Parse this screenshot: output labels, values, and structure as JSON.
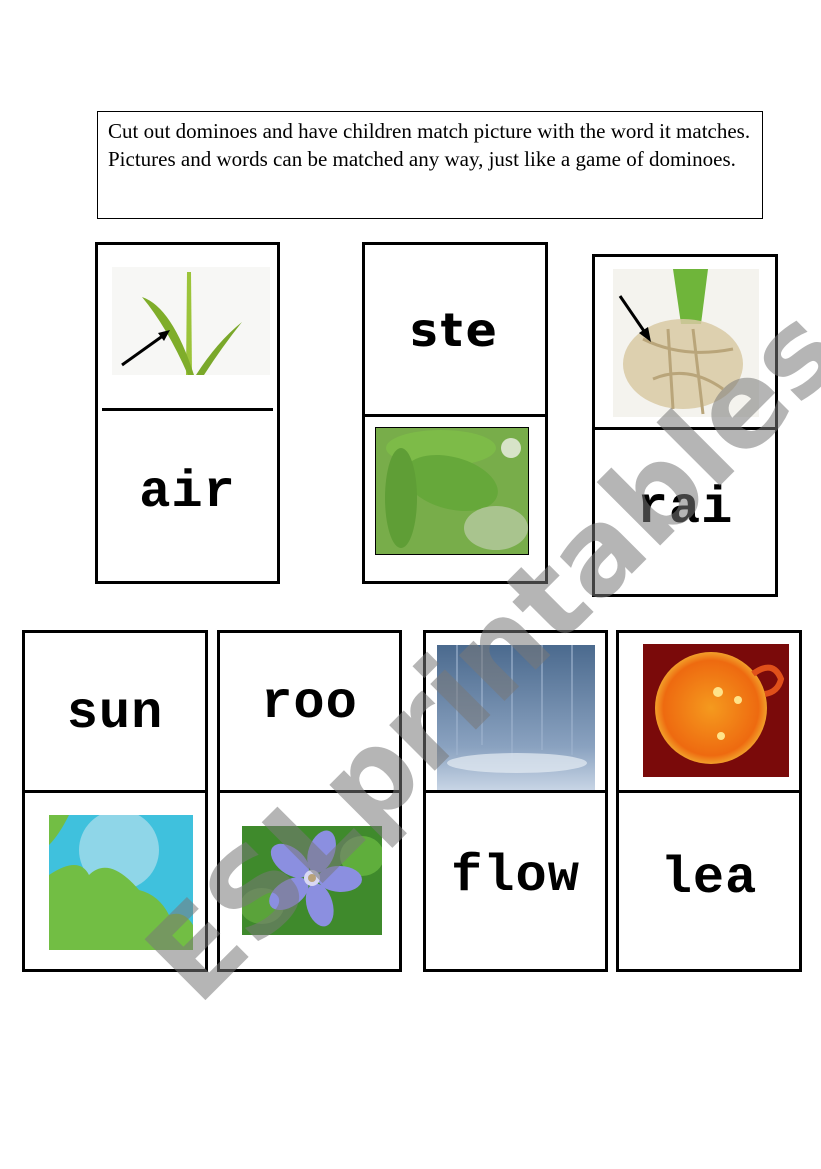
{
  "instructions": "Cut out dominoes and have children match picture with the word it matches.  Pictures and words can be matched any way, just like a game of dominoes.",
  "watermark": "ESLprintables.com",
  "dominoes": [
    {
      "top": {
        "type": "picture",
        "icon": "plant-stem-with-arrow-icon"
      },
      "bottom": {
        "type": "word",
        "text": "air"
      }
    },
    {
      "top": {
        "type": "word",
        "text": "ste"
      },
      "bottom": {
        "type": "picture",
        "icon": "leaves-icon"
      }
    },
    {
      "top": {
        "type": "picture",
        "icon": "roots-with-arrow-icon"
      },
      "bottom": {
        "type": "word",
        "text": "rai"
      }
    },
    {
      "top": {
        "type": "word",
        "text": "sun"
      },
      "bottom": {
        "type": "picture",
        "icon": "air-landscape-icon"
      }
    },
    {
      "top": {
        "type": "word",
        "text": "roo"
      },
      "bottom": {
        "type": "picture",
        "icon": "flower-icon"
      }
    },
    {
      "top": {
        "type": "picture",
        "icon": "rain-icon"
      },
      "bottom": {
        "type": "word",
        "text": "flow"
      }
    },
    {
      "top": {
        "type": "picture",
        "icon": "sun-icon"
      },
      "bottom": {
        "type": "word",
        "text": "lea"
      }
    }
  ]
}
